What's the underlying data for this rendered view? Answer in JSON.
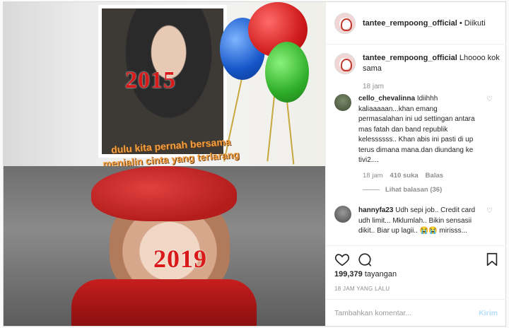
{
  "media": {
    "top_year": "2015",
    "caption_line1": "dulu kita pernah bersama",
    "caption_line2": "menjalin cinta yang terlarang",
    "bottom_year": "2019"
  },
  "header": {
    "username": "tantee_rempoong_official",
    "separator": "•",
    "follow_status": "Diikuti"
  },
  "caption": {
    "username": "tantee_rempoong_official",
    "text": "Lhoooo kok sama",
    "time": "18 jam"
  },
  "comments": [
    {
      "username": "cello_chevalinna",
      "text": "Idiihhh kaliaaaaan...khan emang permasalahan ini ud settingan antara mas fatah dan band republik kelessssss.. Khan abis ini pasti di up terus dimana mana.dan diundang ke tivi2....",
      "time": "18 jam",
      "likes": "410 suka",
      "reply": "Balas",
      "view_replies": "Lihat balasan (36)"
    },
    {
      "username": "hannyfa23",
      "text": "Udh sepi job.. Credit card udh limit... Mklumlah.. Bikin sensasii dikit.. Biar up lagii.. 😭😭 mirisss..."
    }
  ],
  "actions": {
    "icons": [
      "heart-icon",
      "comment-icon",
      "bookmark-icon"
    ],
    "views_count": "199,379",
    "views_label": "tayangan",
    "post_time": "18 JAM YANG LALU"
  },
  "add_comment": {
    "placeholder": "Tambahkan komentar...",
    "post_label": "Kirim"
  }
}
